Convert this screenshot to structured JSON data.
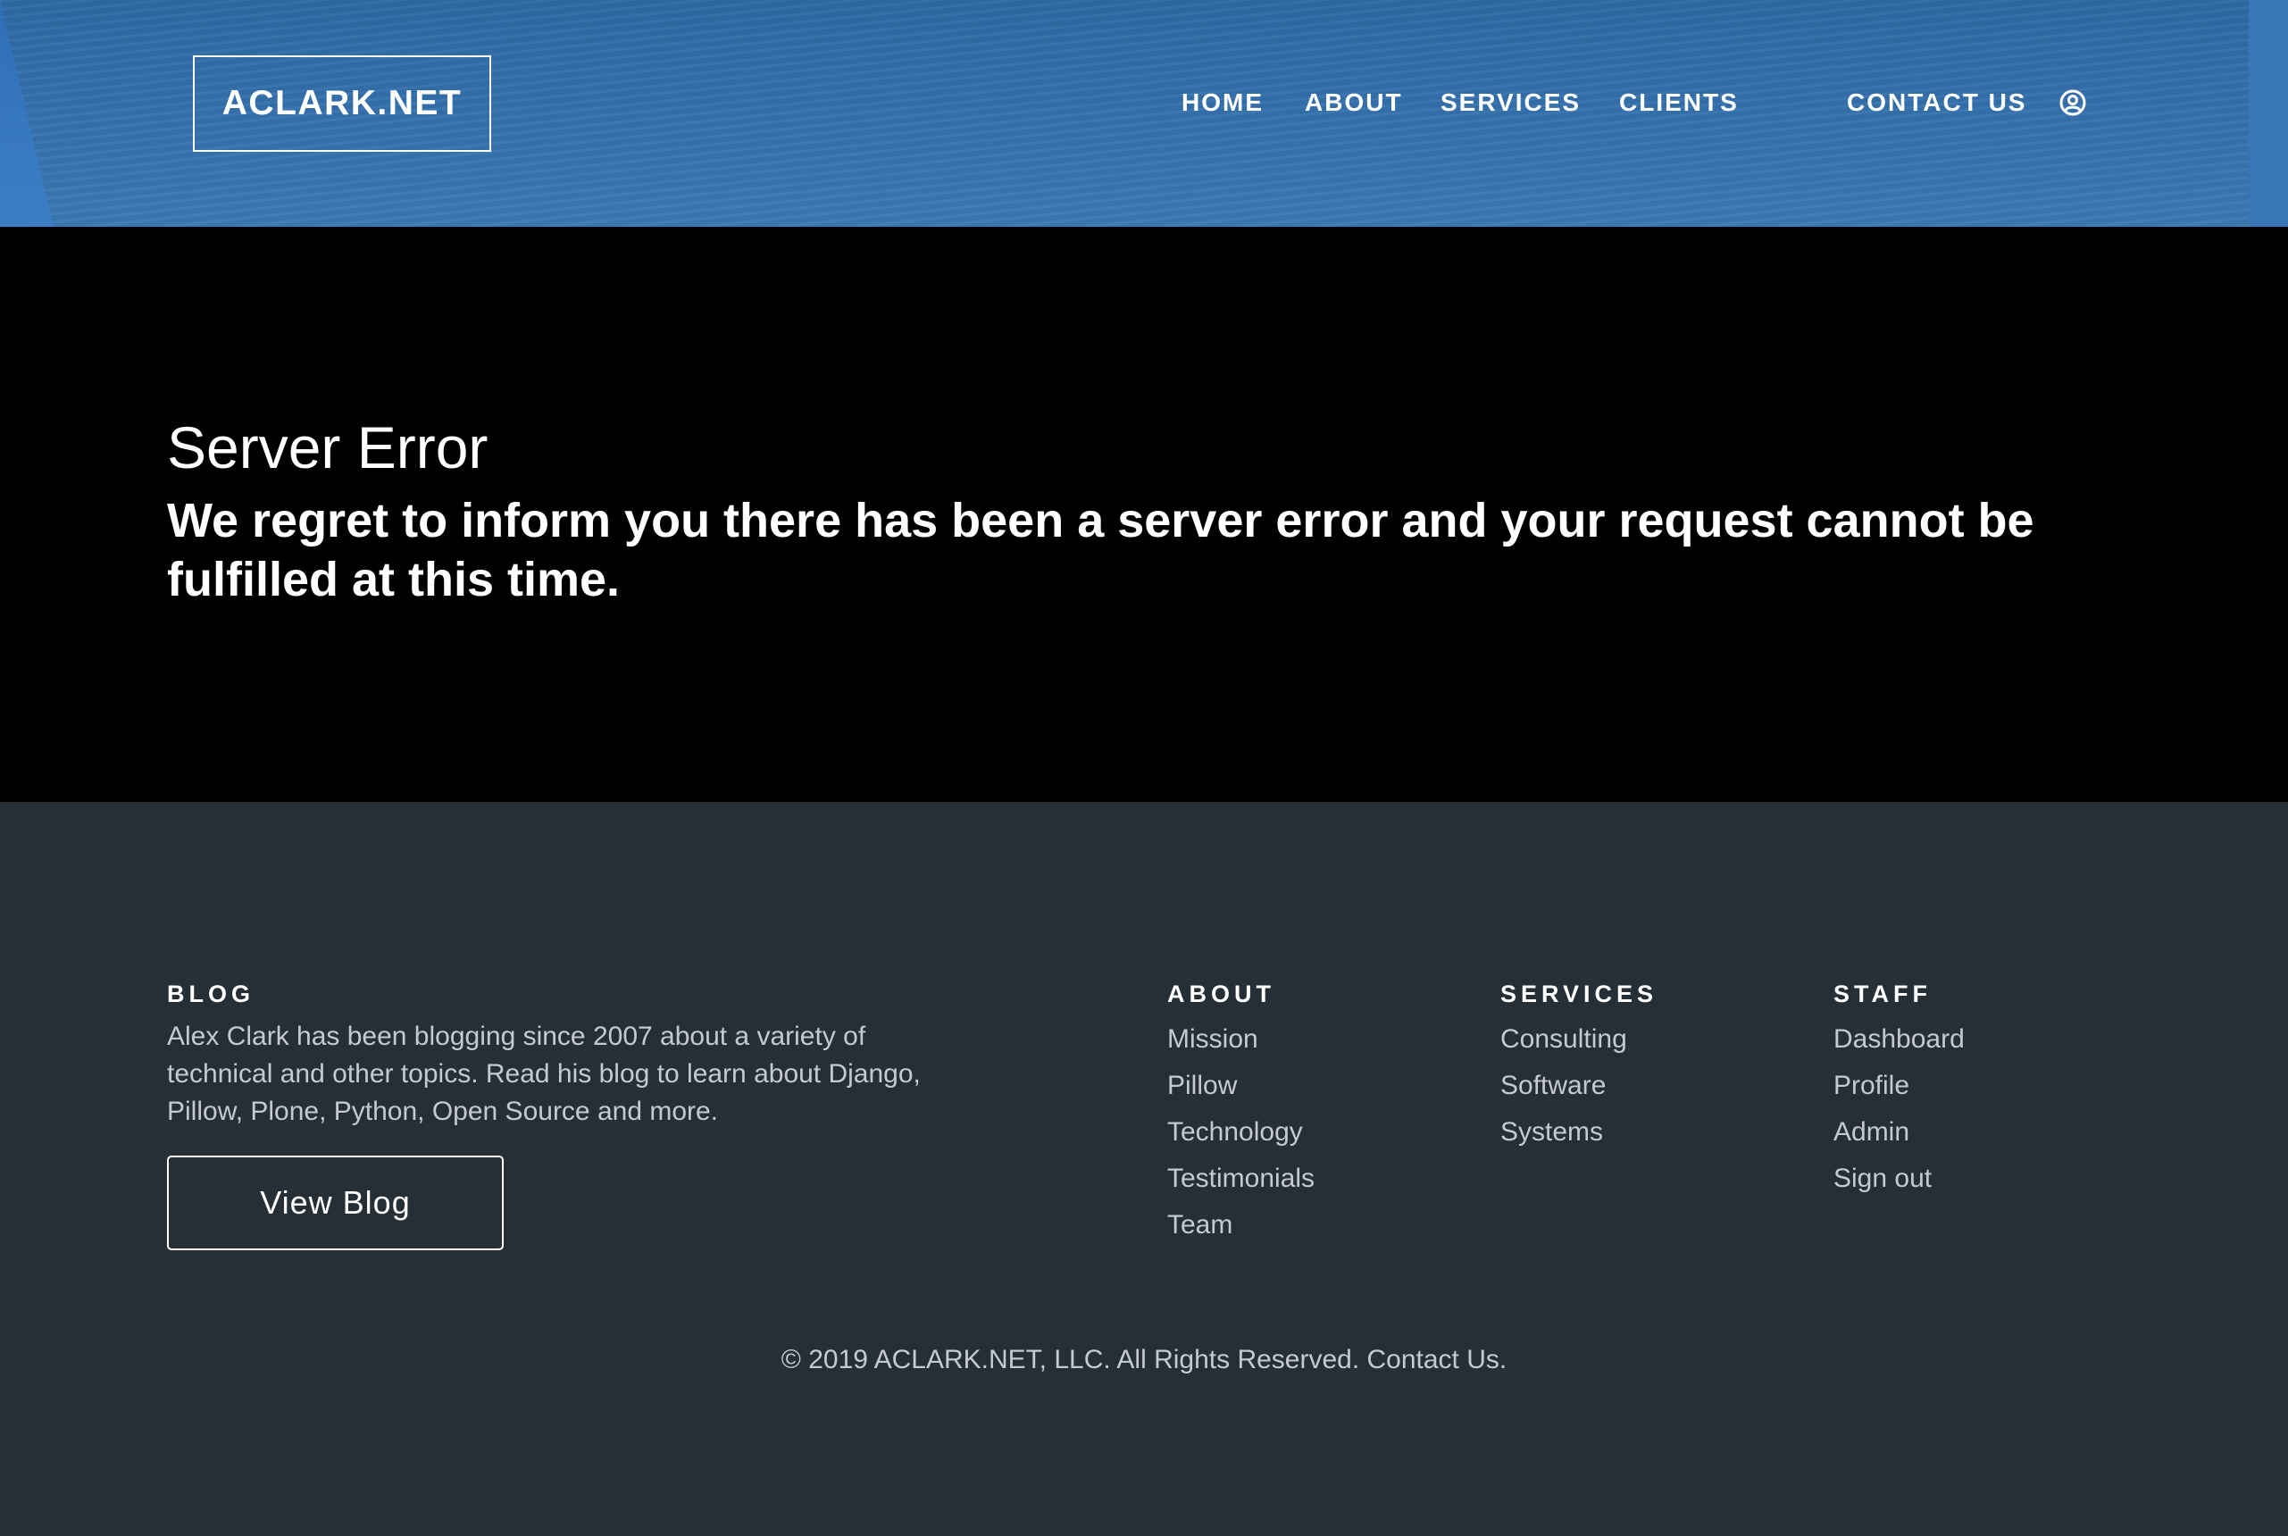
{
  "header": {
    "logo": "ACLARK.NET",
    "nav": {
      "home": "HOME",
      "about": "ABOUT",
      "services": "SERVICES",
      "clients": "CLIENTS",
      "contact": "CONTACT US"
    },
    "user_icon": "user-circle-icon"
  },
  "hero": {
    "title": "Server Error",
    "message": "We regret to inform you there has been a server error and your request cannot be fulfilled at this time."
  },
  "footer": {
    "blog": {
      "heading": "BLOG",
      "text": "Alex Clark has been blogging since 2007 about a variety of technical and other topics. Read his blog to learn about Django, Pillow, Plone, Python, Open Source and more.",
      "button": "View Blog"
    },
    "about": {
      "heading": "ABOUT",
      "links": [
        "Mission",
        "Pillow",
        "Technology",
        "Testimonials",
        "Team"
      ]
    },
    "services": {
      "heading": "SERVICES",
      "links": [
        "Consulting",
        "Software",
        "Systems"
      ]
    },
    "staff": {
      "heading": "STAFF",
      "links": [
        "Dashboard",
        "Profile",
        "Admin",
        "Sign out"
      ]
    },
    "copyright": "© 2019 ACLARK.NET, LLC. All Rights Reserved. Contact Us."
  },
  "colors": {
    "header_blue": "#3571ad",
    "hero_bg": "#000000",
    "footer_bg": "#262e36",
    "footer_text": "#c5cad0"
  }
}
